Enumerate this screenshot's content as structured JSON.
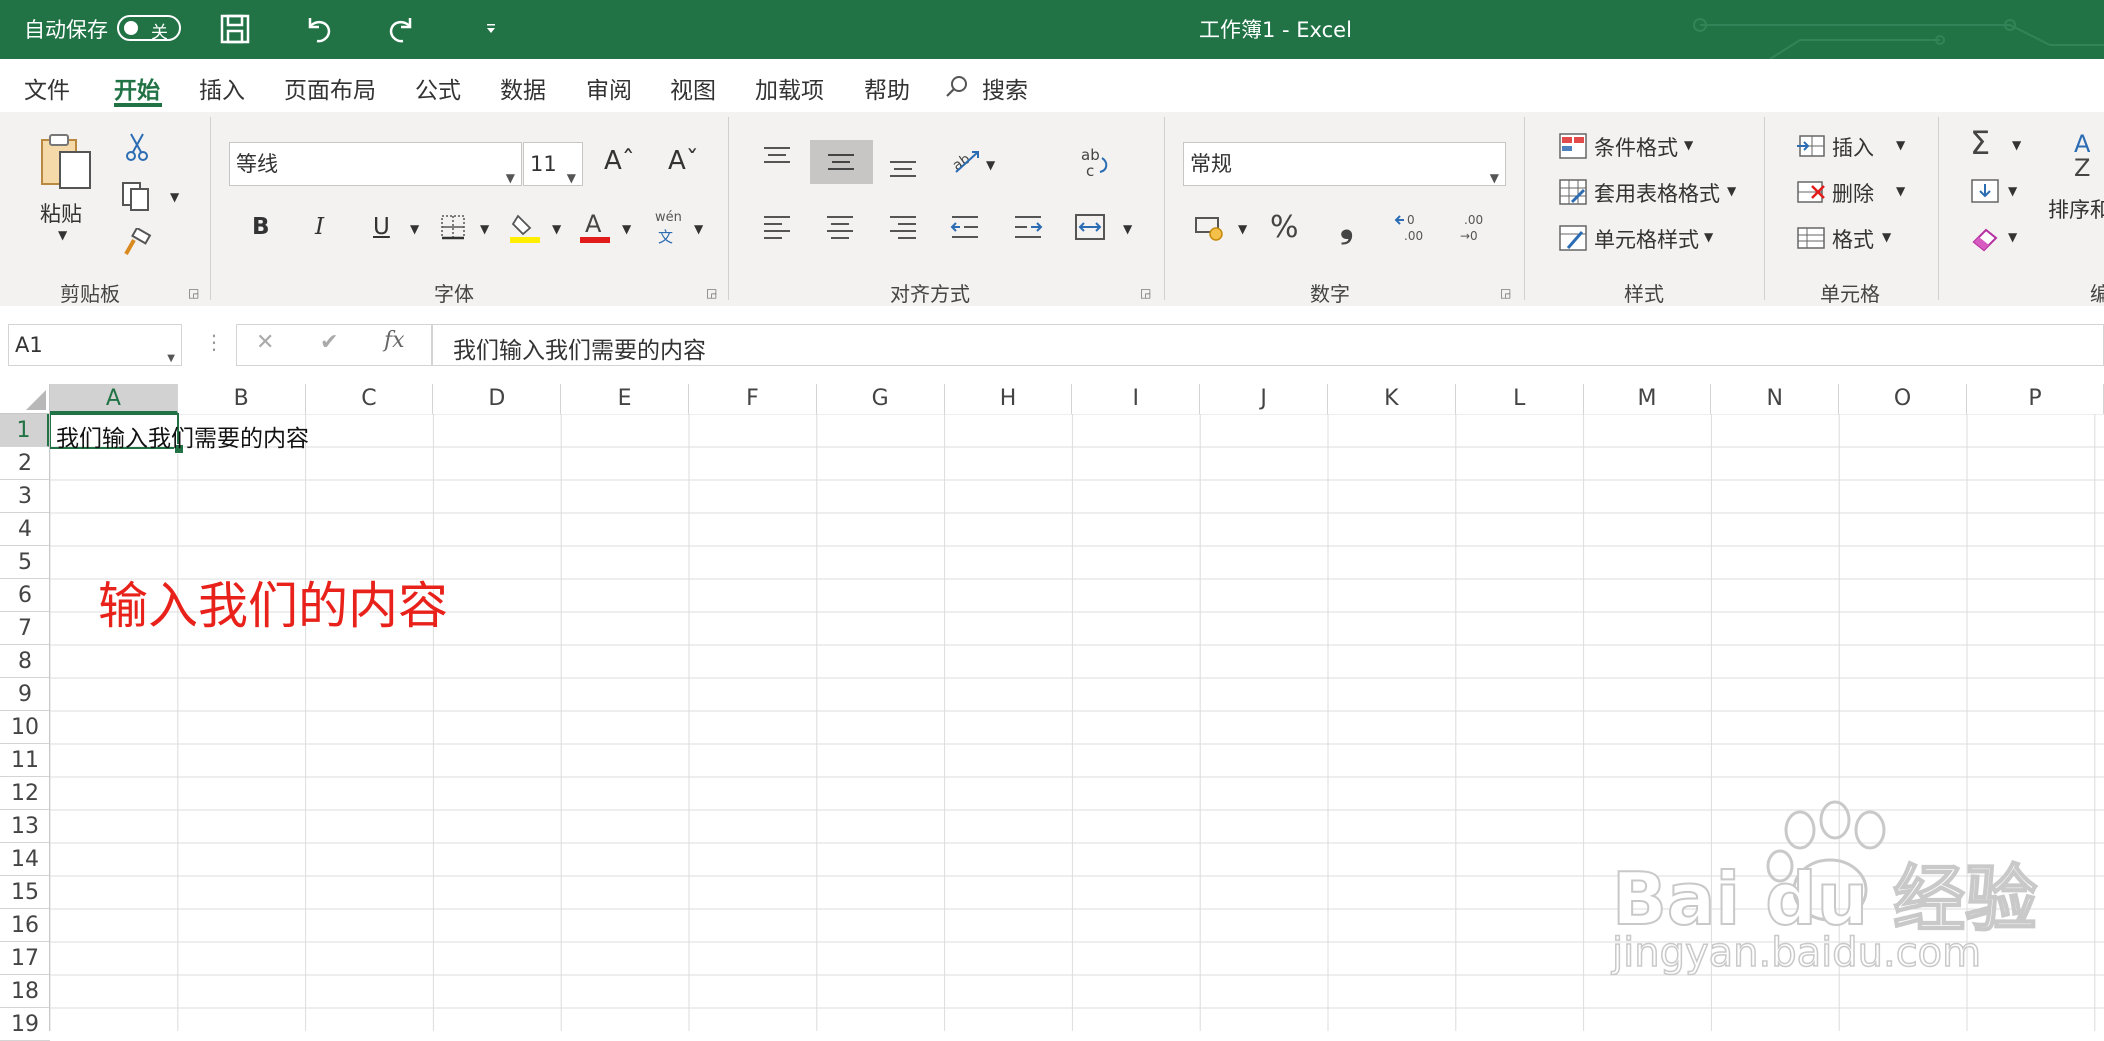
{
  "titlebar": {
    "autosave_label": "自动保存",
    "autosave_state": "关",
    "doc_title": "工作簿1  -  Excel"
  },
  "menu": {
    "tabs": [
      "文件",
      "开始",
      "插入",
      "页面布局",
      "公式",
      "数据",
      "审阅",
      "视图",
      "加载项",
      "帮助"
    ],
    "active_tab": "开始",
    "search_label": "搜索"
  },
  "ribbon": {
    "clipboard": {
      "paste_label": "粘贴",
      "group_label": "剪贴板"
    },
    "font": {
      "font_name": "等线",
      "font_size": "11",
      "group_label": "字体",
      "bold": "B",
      "italic": "I",
      "underline": "U",
      "phonetic_top": "wén",
      "phonetic_bottom": "文"
    },
    "alignment": {
      "group_label": "对齐方式"
    },
    "number": {
      "format": "常规",
      "group_label": "数字",
      "percent": "%",
      "comma": "❟"
    },
    "styles": {
      "conditional": "条件格式",
      "table": "套用表格格式",
      "cell": "单元格样式",
      "group_label": "样式"
    },
    "cells": {
      "insert": "插入",
      "delete": "删除",
      "format": "格式",
      "group_label": "单元格"
    },
    "editing": {
      "sort_label": "排序和",
      "group_label_partial": "编"
    }
  },
  "formula_bar": {
    "name_box": "A1",
    "content": "我们输入我们需要的内容",
    "fx": "fx"
  },
  "grid": {
    "columns": [
      "A",
      "B",
      "C",
      "D",
      "E",
      "F",
      "G",
      "H",
      "I",
      "J",
      "K",
      "L",
      "M",
      "N",
      "O",
      "P"
    ],
    "rows": [
      "1",
      "2",
      "3",
      "4",
      "5",
      "6",
      "7",
      "8",
      "9",
      "10",
      "11",
      "12",
      "13",
      "14",
      "15",
      "16",
      "17",
      "18",
      "19"
    ],
    "cell_a1": "我们输入我们需要的内容",
    "selected_cell": "A1"
  },
  "annotation": {
    "text": "输入我们的内容",
    "color": "#e8221b"
  },
  "watermark": {
    "brand": "Bai du 经验",
    "url": "jingyan.baidu.com"
  },
  "colors": {
    "excel_green": "#217346",
    "ribbon_bg": "#f3f2f1"
  }
}
